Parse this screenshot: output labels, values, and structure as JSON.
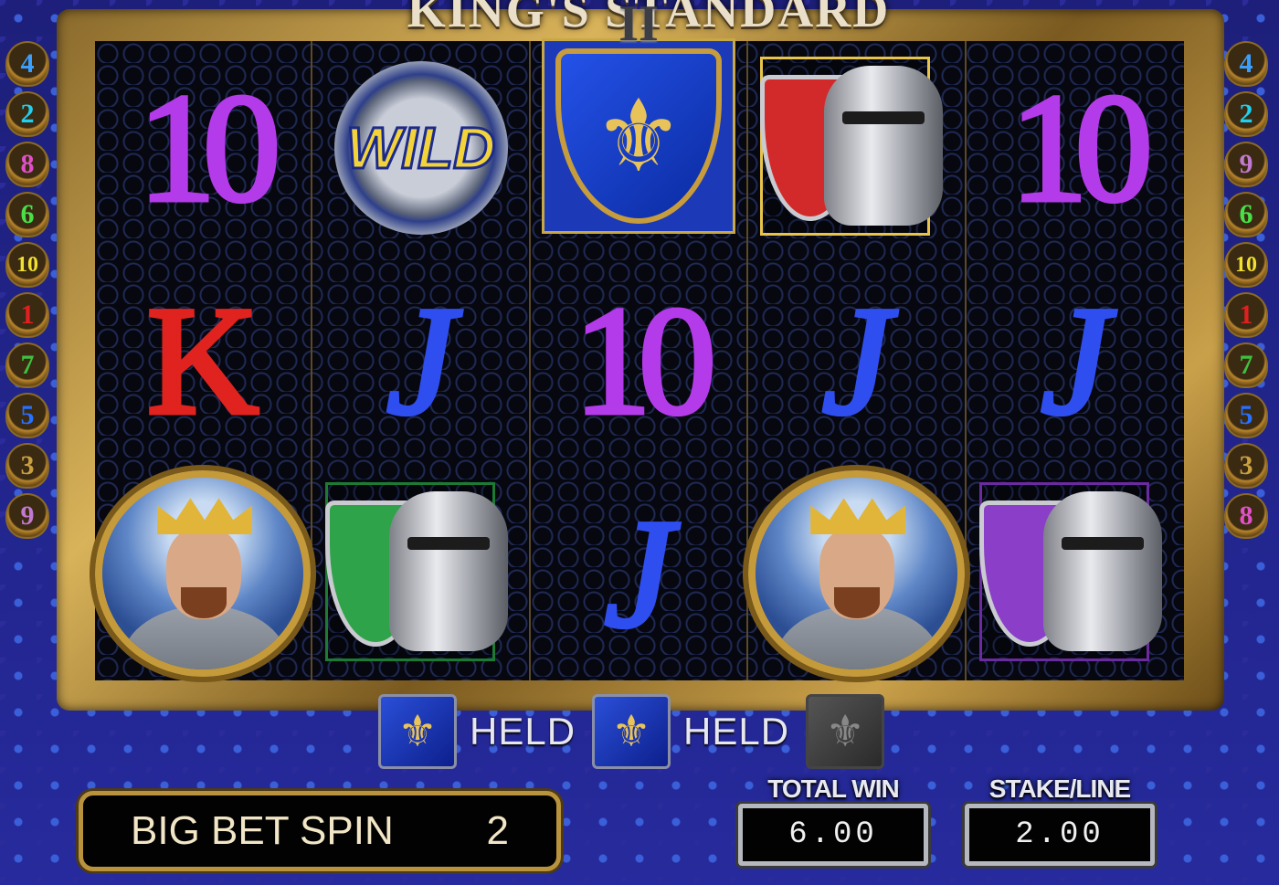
{
  "game": {
    "title": "KING'S STANDARD",
    "title_numeral": "II"
  },
  "paylines": {
    "left": [
      {
        "num": "4",
        "color": "#3aa0ff"
      },
      {
        "num": "2",
        "color": "#1fd0f0"
      },
      {
        "num": "8",
        "color": "#e050c8"
      },
      {
        "num": "6",
        "color": "#48e048"
      },
      {
        "num": "10",
        "color": "#f0e030"
      },
      {
        "num": "1",
        "color": "#e02020"
      },
      {
        "num": "7",
        "color": "#40c040"
      },
      {
        "num": "5",
        "color": "#2870ff"
      },
      {
        "num": "3",
        "color": "#c8a040"
      },
      {
        "num": "9",
        "color": "#c07ad0"
      }
    ],
    "right": [
      {
        "num": "4",
        "color": "#3aa0ff"
      },
      {
        "num": "2",
        "color": "#1fd0f0"
      },
      {
        "num": "9",
        "color": "#c07ad0"
      },
      {
        "num": "6",
        "color": "#48e048"
      },
      {
        "num": "10",
        "color": "#f0e030"
      },
      {
        "num": "1",
        "color": "#e02020"
      },
      {
        "num": "7",
        "color": "#40c040"
      },
      {
        "num": "5",
        "color": "#2870ff"
      },
      {
        "num": "3",
        "color": "#c8a040"
      },
      {
        "num": "8",
        "color": "#e050c8"
      }
    ]
  },
  "reels": [
    [
      "10",
      "K",
      "king"
    ],
    [
      "WILD",
      "J",
      "green-helm"
    ],
    [
      "fleur-shield",
      "10",
      "J"
    ],
    [
      "red-helm",
      "J",
      "king"
    ],
    [
      "10",
      "J",
      "purple-helm"
    ]
  ],
  "symbols": {
    "ten_label": "10",
    "jack_label": "J",
    "king_label": "K",
    "wild_label": "WILD",
    "fleur_glyph": "⚜"
  },
  "held": {
    "label_1": "HELD",
    "label_2": "HELD",
    "icon_glyph": "⚜"
  },
  "controls": {
    "big_bet_label": "BIG BET SPIN",
    "big_bet_value": "2",
    "total_win_label": "TOTAL WIN",
    "total_win_value": "6.00",
    "stake_label": "STAKE/LINE",
    "stake_value": "2.00"
  }
}
